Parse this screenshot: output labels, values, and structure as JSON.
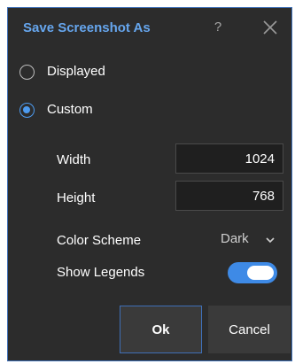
{
  "dialog": {
    "title": "Save Screenshot As",
    "help_label": "?",
    "close_icon": "close-icon"
  },
  "mode": {
    "options": [
      {
        "label": "Displayed",
        "selected": false
      },
      {
        "label": "Custom",
        "selected": true
      }
    ]
  },
  "custom": {
    "width_label": "Width",
    "width_value": "1024",
    "height_label": "Height",
    "height_value": "768",
    "color_scheme_label": "Color Scheme",
    "color_scheme_value": "Dark",
    "show_legends_label": "Show Legends",
    "show_legends_on": true
  },
  "buttons": {
    "ok_label": "Ok",
    "cancel_label": "Cancel"
  },
  "colors": {
    "accent": "#4d9bf0",
    "title": "#66a6ee",
    "background": "#2c2c2c",
    "border": "#3f6fb6"
  }
}
